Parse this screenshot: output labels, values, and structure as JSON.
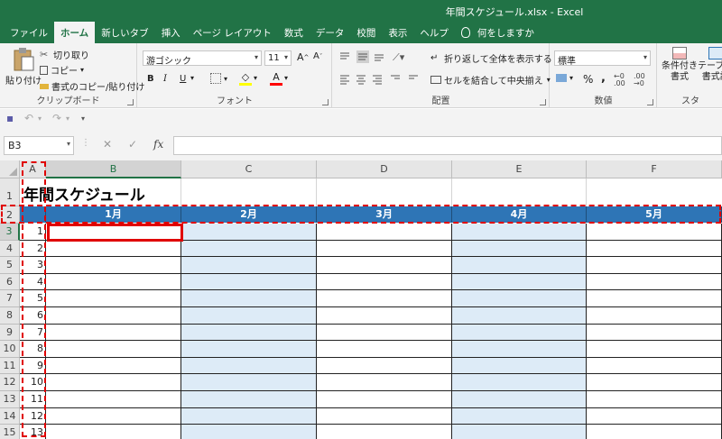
{
  "window": {
    "title": "年間スケジュール.xlsx  -  Excel"
  },
  "tabs": [
    "ファイル",
    "ホーム",
    "新しいタブ",
    "挿入",
    "ページ レイアウト",
    "数式",
    "データ",
    "校閲",
    "表示",
    "ヘルプ"
  ],
  "tell_me": "何をしますか",
  "ribbon": {
    "clipboard": {
      "paste": "貼り付け",
      "cut": "切り取り",
      "copy": "コピー",
      "format_painter": "書式のコピー/貼り付け",
      "label": "クリップボード"
    },
    "font": {
      "name": "游ゴシック",
      "size": "11",
      "bold": "B",
      "italic": "I",
      "underline": "U",
      "label": "フォント"
    },
    "alignment": {
      "wrap": "折り返して全体を表示する",
      "merge": "セルを結合して中央揃え",
      "label": "配置"
    },
    "number": {
      "format": "標準",
      "percent": "%",
      "comma": ",",
      "label": "数値"
    },
    "styles": {
      "conditional": "条件付き",
      "conditional2": "書式",
      "table": "テーブル",
      "table2": "書式設",
      "label": "スタ"
    }
  },
  "formula_bar": {
    "name_box": "B3",
    "fx": "fx",
    "cancel": "✕",
    "enter": "✓",
    "value": ""
  },
  "columns": [
    "A",
    "B",
    "C",
    "D",
    "E",
    "F"
  ],
  "rows": [
    "1",
    "2",
    "3",
    "4",
    "5",
    "6",
    "7",
    "8",
    "9",
    "10",
    "11",
    "12",
    "13",
    "14",
    "15"
  ],
  "sheet": {
    "title": "年間スケジュール",
    "months": [
      "1月",
      "2月",
      "3月",
      "4月",
      "5月"
    ],
    "numbers": [
      "1",
      "2",
      "3",
      "4",
      "5",
      "6",
      "7",
      "8",
      "9",
      "10",
      "11",
      "12",
      "13"
    ]
  },
  "colors": {
    "excel_green": "#217346",
    "header_blue": "#2e75b6",
    "light_blue": "#ddebf7",
    "highlight_red": "#e00000"
  }
}
